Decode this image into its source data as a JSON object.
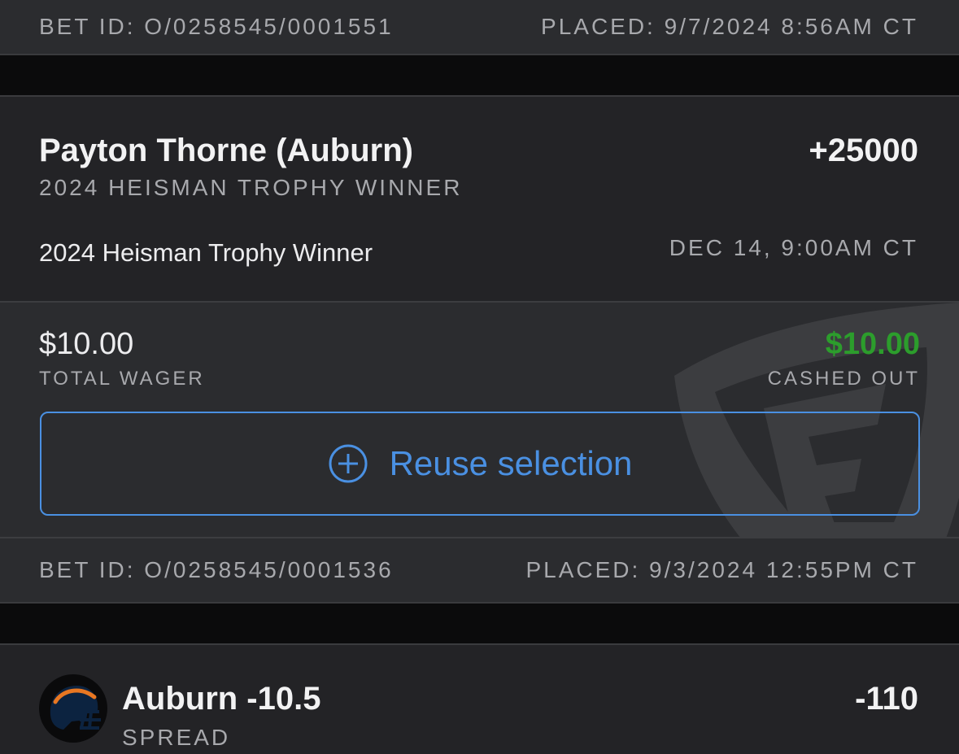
{
  "top_footer": {
    "bet_id": "BET ID: O/0258545/0001551",
    "placed": "PLACED: 9/7/2024 8:56AM CT"
  },
  "bet_card_1": {
    "selection": "Payton Thorne (Auburn)",
    "odds": "+25000",
    "market": "2024 HEISMAN TROPHY WINNER",
    "event": "2024 Heisman Trophy Winner",
    "event_time": "DEC 14, 9:00AM CT",
    "total_wager_amount": "$10.00",
    "total_wager_label": "TOTAL WAGER",
    "cashed_out_amount": "$10.00",
    "cashed_out_label": "CASHED OUT",
    "reuse_label": "Reuse selection",
    "bet_id": "BET ID: O/0258545/0001536",
    "placed": "PLACED: 9/3/2024 12:55PM CT"
  },
  "bet_card_2": {
    "selection": "Auburn -10.5",
    "market": "SPREAD",
    "odds": "-110",
    "logo_icon": "auburn-helmet-icon"
  },
  "colors": {
    "accent_blue": "#4a90e2",
    "cashout_green": "#2c9d2c",
    "card_bg": "#232326",
    "card_footer_bg": "#2b2c2f",
    "gap_bg": "#0b0b0c",
    "helmet_navy": "#0c2340",
    "helmet_orange": "#e87722"
  }
}
